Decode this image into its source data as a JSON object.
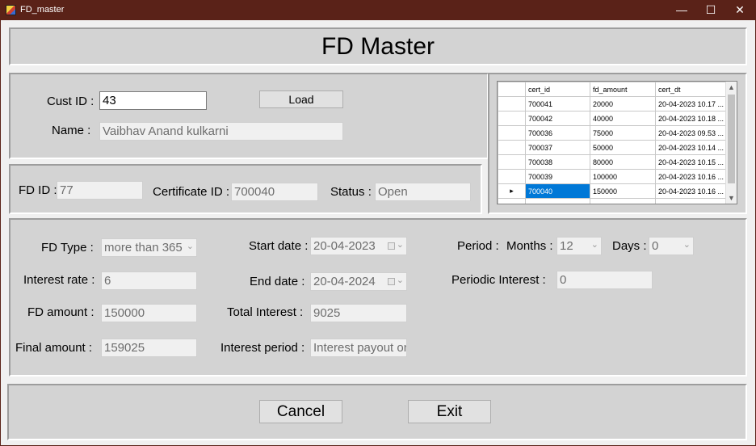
{
  "window": {
    "title": "FD_master",
    "minimize": "—",
    "maximize": "☐",
    "close": "✕"
  },
  "header": {
    "title": "FD Master"
  },
  "customer": {
    "cust_id_label": "Cust ID :",
    "cust_id_value": "43",
    "load_label": "Load",
    "name_label": "Name :",
    "name_value": "Vaibhav Anand kulkarni"
  },
  "fd": {
    "fd_id_label": "FD ID :",
    "fd_id_value": "77",
    "cert_id_label": "Certificate ID :",
    "cert_id_value": "700040",
    "status_label": "Status :",
    "status_value": "Open"
  },
  "grid": {
    "columns": [
      "cert_id",
      "fd_amount",
      "cert_dt"
    ],
    "rows": [
      [
        "700041",
        "20000",
        "20-04-2023 10.17 ..."
      ],
      [
        "700042",
        "40000",
        "20-04-2023 10.18 ..."
      ],
      [
        "700036",
        "75000",
        "20-04-2023 09.53 ..."
      ],
      [
        "700037",
        "50000",
        "20-04-2023 10.14 ..."
      ],
      [
        "700038",
        "80000",
        "20-04-2023 10.15 ..."
      ],
      [
        "700039",
        "100000",
        "20-04-2023 10.16 ..."
      ],
      [
        "700040",
        "150000",
        "20-04-2023 10.16 ..."
      ]
    ],
    "selected_row": 6
  },
  "details": {
    "fd_type_label": "FD Type :",
    "fd_type_value": "more than 365",
    "start_date_label": "Start date :",
    "start_date_value": "20-04-2023",
    "period_label": "Period :",
    "months_label": "Months :",
    "months_value": "12",
    "days_label": "Days :",
    "days_value": "0",
    "interest_rate_label": "Interest rate :",
    "interest_rate_value": "6",
    "end_date_label": "End date :",
    "end_date_value": "20-04-2024",
    "periodic_interest_label": "Periodic Interest :",
    "periodic_interest_value": "0",
    "fd_amount_label": "FD amount :",
    "fd_amount_value": "150000",
    "total_interest_label": "Total Interest :",
    "total_interest_value": "9025",
    "final_amount_label": "Final amount :",
    "final_amount_value": "159025",
    "interest_period_label": "Interest period :",
    "interest_period_value": "Interest payout on"
  },
  "footer": {
    "cancel_label": "Cancel",
    "exit_label": "Exit"
  }
}
